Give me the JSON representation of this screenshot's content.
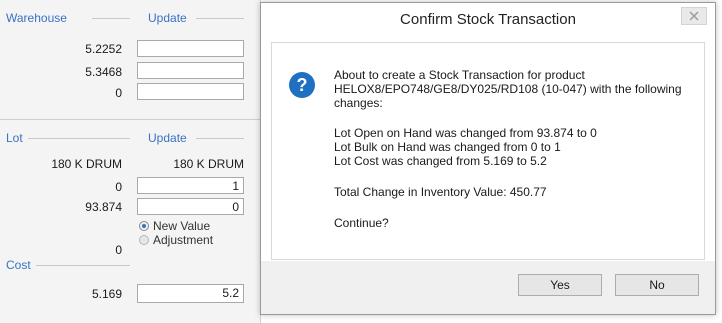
{
  "warehouse": {
    "label": "Warehouse",
    "update_label": "Update",
    "values": [
      "5.2252",
      "5.3468",
      "0"
    ],
    "inputs": [
      "",
      "",
      ""
    ]
  },
  "lot": {
    "label": "Lot",
    "update_label": "Update",
    "container": "180 K DRUM",
    "container_update": "180 K DRUM",
    "bulk_on_hand": "0",
    "bulk_input": "1",
    "open_on_hand": "93.874",
    "open_input": "0",
    "radio_new": "New Value",
    "radio_adjust": "Adjustment",
    "bottom_value": "0"
  },
  "cost": {
    "label": "Cost",
    "value": "5.169",
    "input": "5.2"
  },
  "dialog": {
    "title": "Confirm Stock Transaction",
    "close_glyph": "×",
    "line1": "About to create a Stock Transaction for product",
    "line2": "HELOX8/EPO748/GE8/DY025/RD108 (10-047) with the following",
    "line3": "changes:",
    "change1": "Lot Open on Hand was changed from 93.874 to 0",
    "change2": "Lot Bulk on Hand was changed from 0 to 1",
    "change3": "Lot Cost was changed from 5.169 to 5.2",
    "total": "Total Change in Inventory Value: 450.77",
    "prompt": "Continue?",
    "yes_label": "Yes",
    "no_label": "No"
  },
  "colors": {
    "section_label": "#3a72c4",
    "question_icon": "#1f6fc2"
  },
  "icons": {
    "question": "question-icon",
    "close": "close-icon"
  }
}
